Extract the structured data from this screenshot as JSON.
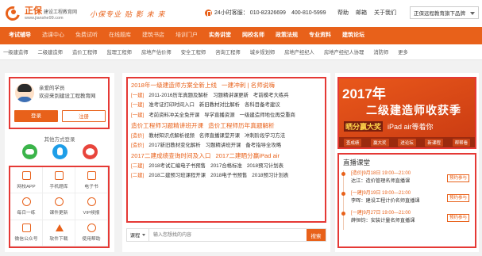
{
  "header": {
    "logo_name": "正保",
    "logo_name_sub": "建设工程教育网",
    "logo_url": "www.jianshe99.com",
    "slogan": "小保专业 贴 影 未 来",
    "hotline_label": "24小时客服：",
    "hotline_number": "010-82326699　400-810-5999",
    "links": [
      "帮助",
      "邮箱",
      "关于我们"
    ],
    "campus_select": "正保远程教育旗下品牌"
  },
  "nav": {
    "items": [
      "考试辅导",
      "选课中心",
      "免费试听",
      "在线题库",
      "建筑书店",
      "培训门户",
      "实务讲堂",
      "网校名师",
      "政策法规",
      "专业资料",
      "建筑论坛"
    ]
  },
  "subnav": {
    "items": [
      "一级建造师",
      "二级建造师",
      "造价工程师",
      "监理工程师",
      "房地产估价师",
      "安全工程师",
      "咨询工程师",
      "城乡规划师",
      "房地产经纪人",
      "房地产经纪人协理",
      "消防师",
      "更多"
    ]
  },
  "user": {
    "greeting_line1": "亲爱的学员",
    "greeting_line2": "欢迎来到建设工程教育网",
    "login_label": "登录",
    "register_label": "注册",
    "other_login": "其他方式登录"
  },
  "services": [
    {
      "label": "网校APP",
      "icon": "phone-icon"
    },
    {
      "label": "手机题库",
      "icon": "mobile-quiz-icon"
    },
    {
      "label": "电子书",
      "icon": "ebook-icon"
    },
    {
      "label": "每日一练",
      "icon": "daily-practice-icon"
    },
    {
      "label": "课件更新",
      "icon": "course-update-icon"
    },
    {
      "label": "VIP候报",
      "icon": "vip-icon"
    },
    {
      "label": "微信公众号",
      "icon": "wechat-account-icon"
    },
    {
      "label": "软件下载",
      "icon": "download-icon"
    },
    {
      "label": "使用帮助",
      "icon": "help-icon"
    }
  ],
  "news": [
    {
      "red": true,
      "items": [
        "2018年一级建造师方案全新上线",
        "一建冲刺 | 名师说嗨"
      ]
    },
    {
      "tag": "[一建]",
      "items": [
        "2011-2016历年真题及解析",
        "习题精讲课更新",
        "考前模考大练兵"
      ]
    },
    {
      "tag": "[一建]",
      "items": [
        "准考证打印时间入口",
        "新旧教材对比解析",
        "各科目备考建议"
      ]
    },
    {
      "tag": "[一建]",
      "items": [
        "考前资料冲关全免开课",
        "导学直播资源",
        "一级建造师地位再受重商"
      ]
    },
    {
      "red": true,
      "items": [
        "造价工程师习题精讲班开课",
        "造价工程师历年真题解析"
      ]
    },
    {
      "tag": "[造价]",
      "items": [
        "教材知识点解析视频",
        "名师直播课堂开课",
        "冲刺阶段学习方法"
      ]
    },
    {
      "tag": "[造价]",
      "items": [
        "2017新旧教材变化解析",
        "习题精讲班开课",
        "备考指导全攻略"
      ]
    },
    {
      "red": true,
      "items": [
        "2017二建成绩查询时间及入口",
        "2017二建晒分赢iPad air"
      ]
    },
    {
      "tag": "[二建]",
      "items": [
        "2018考试汇编电子书预售",
        "2017合格标准",
        "2018预习计划表"
      ]
    },
    {
      "tag": "[二建]",
      "items": [
        "2018二建预习班课程开课",
        "2018电子书预售",
        "2018预习计划表"
      ]
    }
  ],
  "search": {
    "category": "课程",
    "placeholder": "输入您想找的内容",
    "button": "搜索"
  },
  "banner": {
    "year": "2017年",
    "main": "二级建造师收获季",
    "sub_highlight": "晒分赢大奖",
    "sub_text": "iPad air等着你",
    "menu": [
      "查成绩",
      "赢大奖",
      "进论坛",
      "新课程",
      "帮帮看"
    ]
  },
  "live": {
    "title": "直播课堂",
    "items": [
      {
        "time": "[造价]9月18日 19:00—21:00",
        "name": "达江：造价管理名师直播课",
        "button": "预约参与"
      },
      {
        "time": "[一建]9月19日 19:00—21:00",
        "name": "李晖：建设工程计价名师直播课",
        "button": "预约参与"
      },
      {
        "time": "[一建]9月27日 19:00—21:00",
        "name": "薛恒钧：安装计量名师直播课",
        "button": "预约参与"
      }
    ]
  }
}
